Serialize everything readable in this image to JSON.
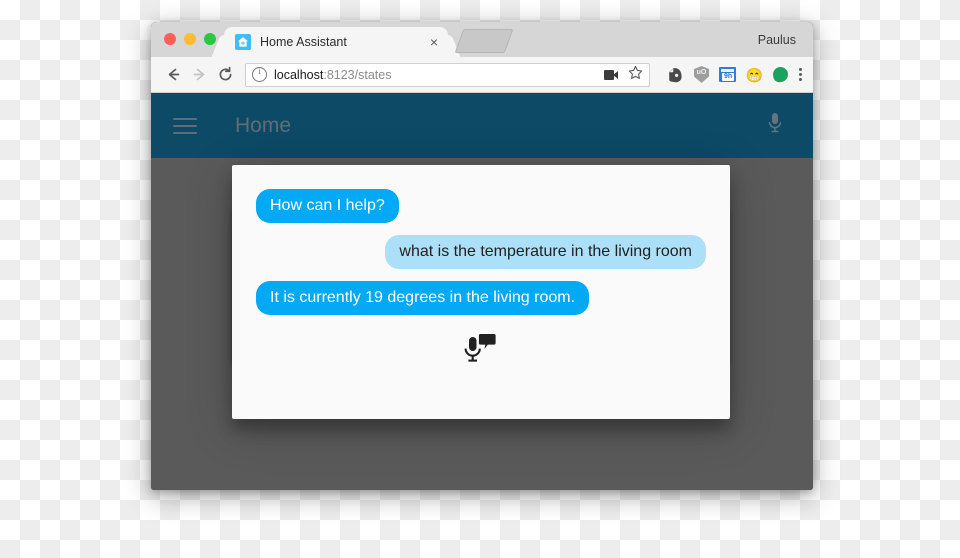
{
  "browser": {
    "traffic_lights": [
      {
        "name": "close",
        "color": "#ff5f57"
      },
      {
        "name": "minimize",
        "color": "#febc2e"
      },
      {
        "name": "zoom",
        "color": "#28c840"
      }
    ],
    "tab": {
      "title": "Home Assistant",
      "favicon": "home-assistant-icon",
      "close_label": "×"
    },
    "profile_name": "Paulus",
    "toolbar": {
      "back_label": "←",
      "forward_label": "→",
      "reload_label": "↻",
      "url_host": "localhost",
      "url_rest": ":8123/states",
      "security_icon": "info-circle-icon",
      "cast_icon": "video-camera-icon",
      "bookmark_label": "☆",
      "extensions": [
        {
          "name": "evernote-extension-icon",
          "label": ""
        },
        {
          "name": "ublock-shield-extension-icon",
          "label": "uO"
        },
        {
          "name": "nine-hours-extension-icon",
          "label": "9h"
        },
        {
          "name": "emoji-extension-icon",
          "label": "😁"
        },
        {
          "name": "green-blob-extension-icon",
          "label": ""
        }
      ],
      "menu_label": "⋮"
    }
  },
  "app": {
    "menu_icon": "hamburger-menu-icon",
    "title": "Home",
    "mic_icon": "microphone-icon"
  },
  "dialog": {
    "messages": [
      {
        "side": "left",
        "role": "assistant",
        "text": "How can I help?"
      },
      {
        "side": "right",
        "role": "user",
        "text": "what is the temperature in the living room"
      },
      {
        "side": "left",
        "role": "assistant",
        "text": "It is currently 19 degrees in the living room."
      }
    ],
    "listen_icon": "microphone-speech-bubble-icon",
    "colors": {
      "assistant_bubble": "#03a9f4",
      "user_bubble": "#ace0f9",
      "surface": "#fafafa"
    }
  },
  "theme": {
    "header_background": "#0c4a66",
    "scrim": "#5a5a5a",
    "accent": "#03a9f4"
  }
}
